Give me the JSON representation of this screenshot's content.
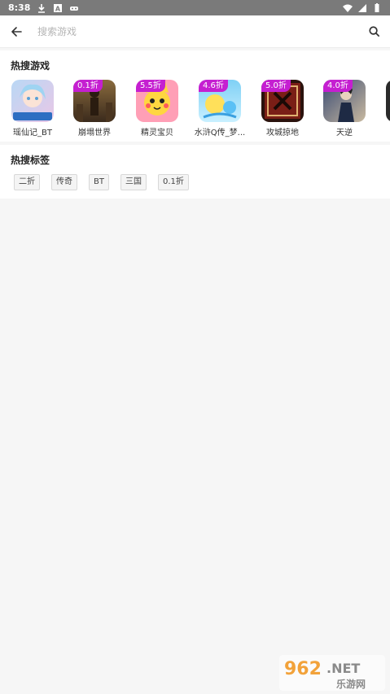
{
  "status_bar": {
    "time": "8:38",
    "icons": [
      "download-icon",
      "notification-a-icon",
      "game-controller-icon",
      "wifi-icon",
      "signal-icon",
      "battery-icon"
    ]
  },
  "search": {
    "placeholder": "搜索游戏",
    "back_icon": "arrow-left-icon",
    "search_icon": "search-icon"
  },
  "hot_games": {
    "title": "热搜游戏",
    "items": [
      {
        "name": "瑶仙记_BT",
        "discount": "",
        "icon_colors": [
          "#b9d8f5",
          "#e9c7e6"
        ]
      },
      {
        "name": "崩塌世界",
        "discount": "0.1折",
        "icon_colors": [
          "#3a2a1c",
          "#8a6b3e"
        ]
      },
      {
        "name": "精灵宝贝",
        "discount": "5.5折",
        "icon_colors": [
          "#ffd640",
          "#ff6e8a"
        ]
      },
      {
        "name": "水浒Q传_梦...",
        "discount": "4.6折",
        "icon_colors": [
          "#7fd0f5",
          "#ffe05a"
        ]
      },
      {
        "name": "攻城掠地",
        "discount": "5.0折",
        "icon_colors": [
          "#7a1e16",
          "#2a120d"
        ]
      },
      {
        "name": "天逆",
        "discount": "4.0折",
        "icon_colors": [
          "#3a4c74",
          "#c9b9a0"
        ]
      }
    ]
  },
  "hot_tags": {
    "title": "热搜标签",
    "items": [
      "二折",
      "传奇",
      "BT",
      "三国",
      "0.1折"
    ]
  },
  "watermark": {
    "brand": "962.NET",
    "sub": "乐游网"
  }
}
